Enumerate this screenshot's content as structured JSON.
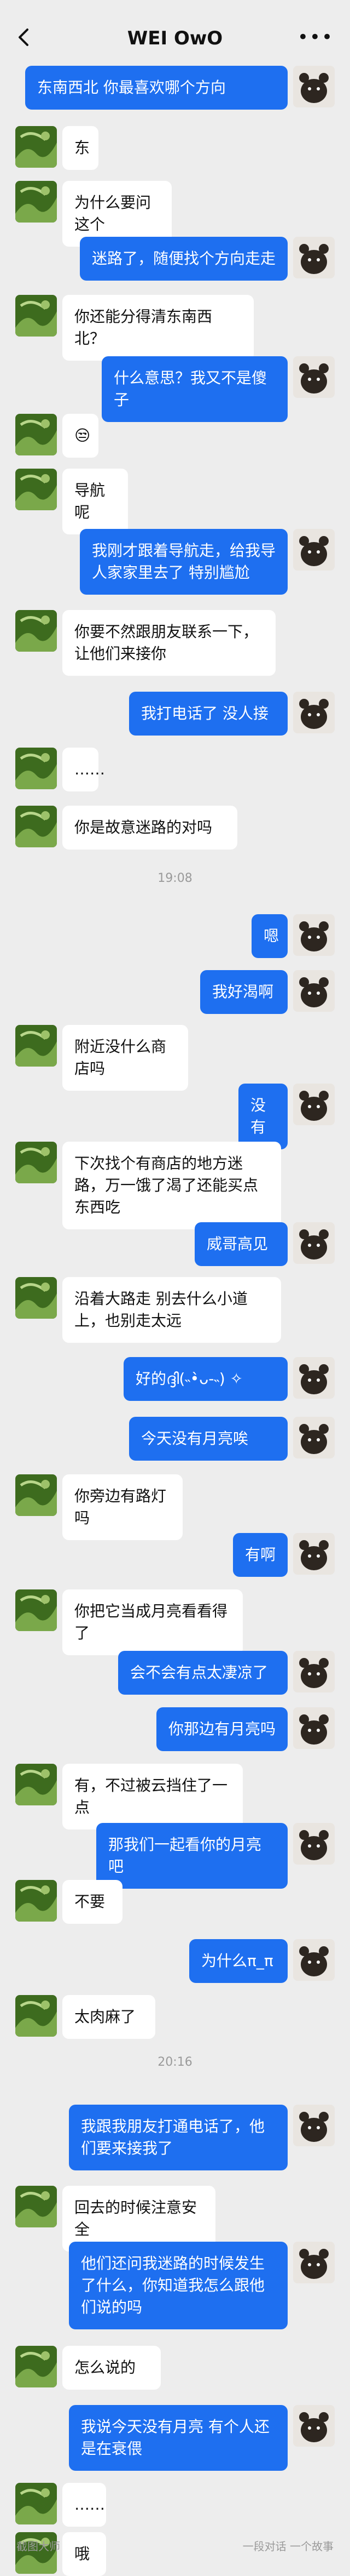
{
  "header": {
    "title": "WEI OwO",
    "more": "•••"
  },
  "timestamps": [
    "19:08",
    "20:16"
  ],
  "messages": [
    {
      "side": "right",
      "text": "东南西北 你最喜欢哪个方向"
    },
    {
      "side": "left",
      "text": "东"
    },
    {
      "side": "left",
      "text": "为什么要问这个"
    },
    {
      "side": "right",
      "text": "迷路了，随便找个方向走走"
    },
    {
      "side": "left",
      "text": "你还能分得清东南西北？"
    },
    {
      "side": "right",
      "text": "什么意思？我又不是傻子"
    },
    {
      "side": "left",
      "text": "😒"
    },
    {
      "side": "left",
      "text": "导航呢"
    },
    {
      "side": "right",
      "text": "我刚才跟着导航走，给我导人家家里去了 特别尴尬"
    },
    {
      "side": "left",
      "text": "你要不然跟朋友联系一下，让他们来接你"
    },
    {
      "side": "right",
      "text": "我打电话了 没人接"
    },
    {
      "side": "left",
      "text": "……"
    },
    {
      "side": "left",
      "text": "你是故意迷路的对吗"
    },
    {
      "side": "right",
      "text": "嗯"
    },
    {
      "side": "right",
      "text": "我好渴啊"
    },
    {
      "side": "left",
      "text": "附近没什么商店吗"
    },
    {
      "side": "right",
      "text": "没有"
    },
    {
      "side": "left",
      "text": "下次找个有商店的地方迷路，万一饿了渴了还能买点东西吃"
    },
    {
      "side": "right",
      "text": "威哥高见"
    },
    {
      "side": "left",
      "text": "沿着大路走 别去什么小道上，也别走太远"
    },
    {
      "side": "right",
      "text": "好的ദ്ദി(˵•̀ᴗ-˵) ✧"
    },
    {
      "side": "right",
      "text": "今天没有月亮唉"
    },
    {
      "side": "left",
      "text": "你旁边有路灯吗"
    },
    {
      "side": "right",
      "text": "有啊"
    },
    {
      "side": "left",
      "text": "你把它当成月亮看看得了"
    },
    {
      "side": "right",
      "text": "会不会有点太凄凉了"
    },
    {
      "side": "right",
      "text": "你那边有月亮吗"
    },
    {
      "side": "left",
      "text": "有，不过被云挡住了一点"
    },
    {
      "side": "right",
      "text": "那我们一起看你的月亮吧"
    },
    {
      "side": "left",
      "text": "不要"
    },
    {
      "side": "right",
      "text": "为什么π_π"
    },
    {
      "side": "left",
      "text": "太肉麻了"
    },
    {
      "side": "right",
      "text": "我跟我朋友打通电话了，他们要来接我了"
    },
    {
      "side": "left",
      "text": "回去的时候注意安全"
    },
    {
      "side": "right",
      "text": "他们还问我迷路的时候发生了什么，你知道我怎么跟他们说的吗"
    },
    {
      "side": "left",
      "text": "怎么说的"
    },
    {
      "side": "right",
      "text": "我说今天没有月亮 有个人还是在衰偎"
    },
    {
      "side": "left",
      "text": "……"
    },
    {
      "side": "left",
      "text": "哦"
    }
  ],
  "watermarks": {
    "left": "截图大师",
    "right": "一段对话 一个故事"
  },
  "colors": {
    "background": "#ededed",
    "bubble_right": "#1e6ff0",
    "bubble_left": "#ffffff"
  }
}
